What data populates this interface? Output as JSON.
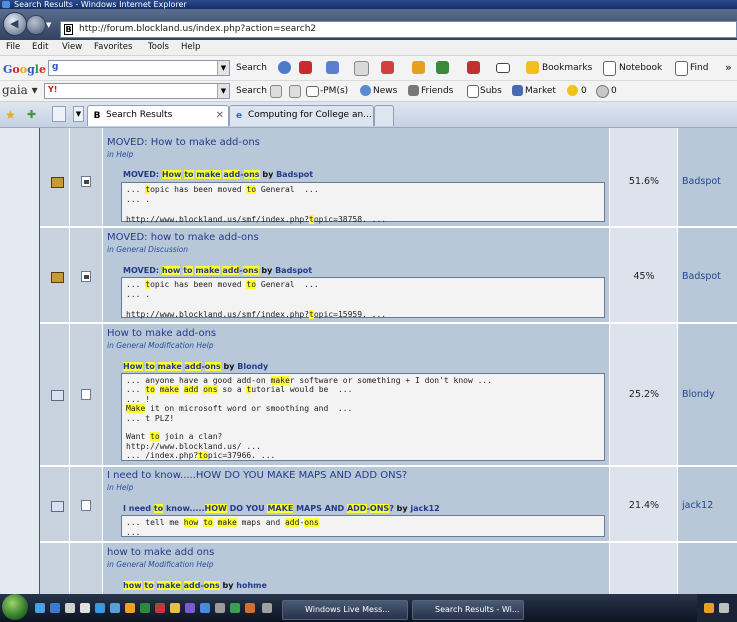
{
  "window": {
    "title": "Search Results - Windows Internet Explorer"
  },
  "address": {
    "url": "http://forum.blockland.us/index.php?action=search2"
  },
  "menu": [
    "File",
    "Edit",
    "View",
    "Favorites",
    "Tools",
    "Help"
  ],
  "google_toolbar": {
    "search_label": "Search",
    "bookmarks_label": "Bookmarks",
    "notebook_label": "Notebook",
    "find_label": "Find"
  },
  "gaia_toolbar": {
    "search_label": "Search",
    "pm_label": "-PM(s)",
    "news_label": "News",
    "friends_label": "Friends",
    "subs_label": "Subs",
    "market_label": "Market",
    "count1": "0",
    "count2": "0"
  },
  "tabs": [
    {
      "label": "Search Results",
      "active": true
    },
    {
      "label": "Computing for College an...",
      "active": false
    }
  ],
  "results": [
    {
      "subject": "MOVED: How to make add-ons",
      "board": "Help",
      "header_title": "MOVED: How to make add-ons",
      "author": "Badspot",
      "quote_lines": [
        "... topic has been moved to General  ...",
        "... .",
        "",
        "http://www.blockland.us/smf/index.php?topic=38758. ..."
      ],
      "relevance": "51.6%",
      "user": "Badspot"
    },
    {
      "subject": "MOVED: how to make add-ons",
      "board": "General Discussion",
      "header_title": "MOVED: how to make add-ons",
      "author": "Badspot",
      "quote_lines": [
        "... topic has been moved to General  ...",
        "... .",
        "",
        "http://www.blockland.us/smf/index.php?topic=15959. ..."
      ],
      "relevance": "45%",
      "user": "Badspot"
    },
    {
      "subject": "How to make add-ons",
      "board": "General Modification Help",
      "header_title": "How to make add-ons",
      "author": "Blondy",
      "quote_lines": [
        "... anyone have a good add-on maker software or something + I don't know ...",
        "... to make add ons so a tutorial would be  ...",
        "... !",
        "Make it on microsoft word or smoothing and  ...",
        "... t PLZ!",
        "",
        "Want to join a clan?",
        "http://www.blockland.us/ ...",
        "... /index.php?topic=37966. ..."
      ],
      "relevance": "25.2%",
      "user": "Blondy"
    },
    {
      "subject": "I need to know.....HOW DO YOU MAKE MAPS AND ADD ONS?",
      "board": "Help",
      "header_title": "I need to know.....HOW DO YOU MAKE MAPS AND ADD-ONS?",
      "author": "jack12",
      "quote_lines": [
        "... tell me how to make maps and add-ons",
        "..."
      ],
      "relevance": "21.4%",
      "user": "jack12"
    },
    {
      "subject": "how to make add ons",
      "board": "General Modification Help",
      "header_title": "how to make add-ons",
      "author": "hohme",
      "quote_lines": [],
      "relevance": "",
      "user": ""
    }
  ],
  "labels": {
    "in_word": "in",
    "by_word": "by"
  },
  "taskbar": {
    "tasks": [
      "Windows Live Mess...",
      "Search Results - Wi..."
    ]
  }
}
